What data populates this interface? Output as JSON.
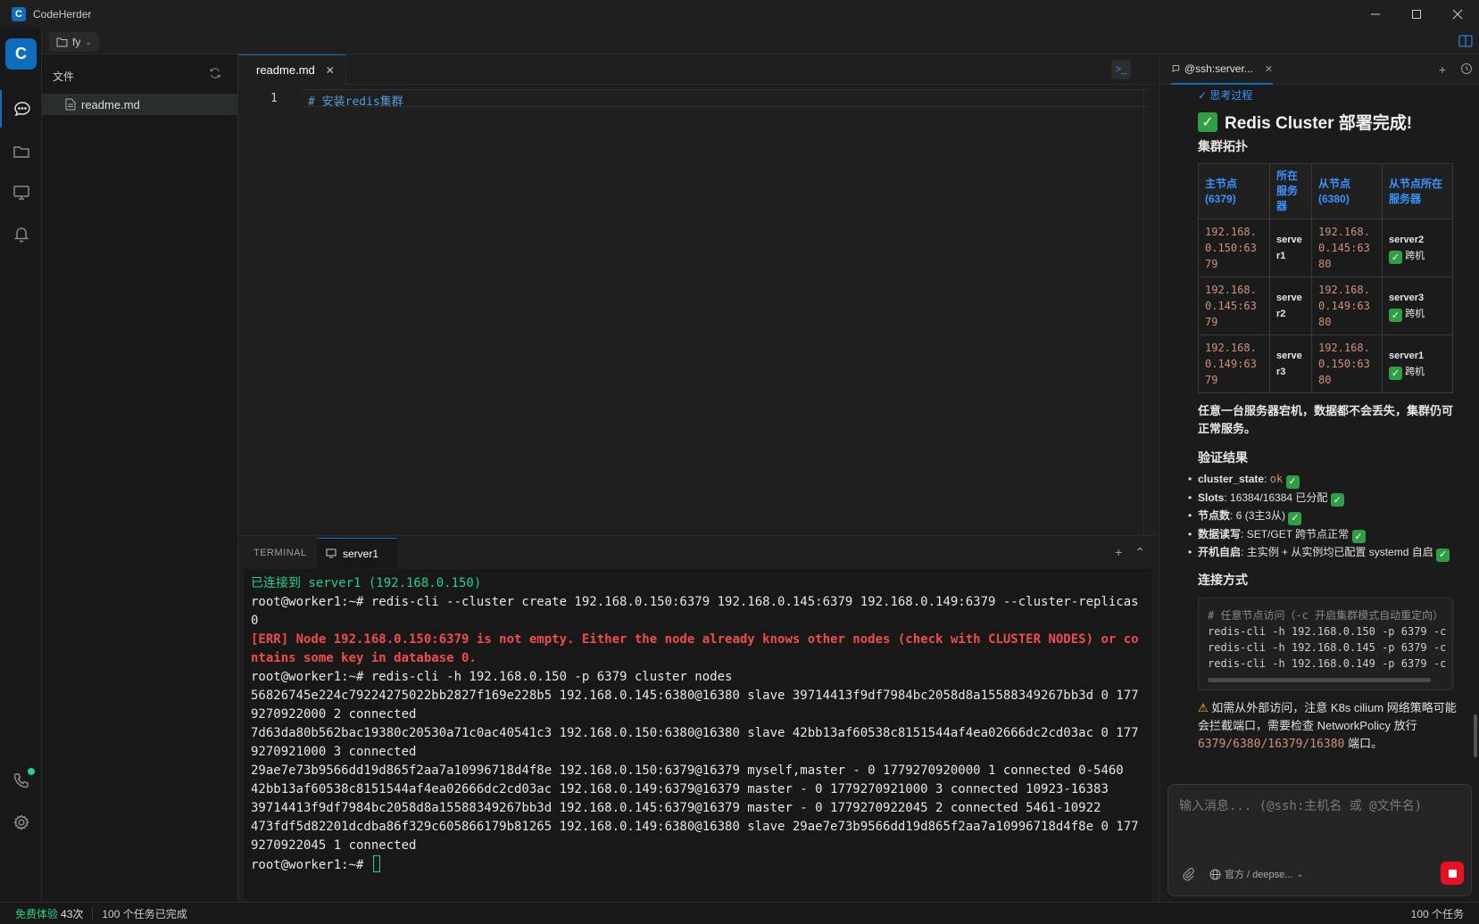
{
  "app": {
    "name": "CodeHerder",
    "logo_letter": "C",
    "accent": "#0e6dbd"
  },
  "activity": {
    "avatar_letter": "C",
    "items": [
      "chat-icon",
      "folder-icon",
      "monitor-icon",
      "bell-icon",
      "phone-icon",
      "gear-icon"
    ],
    "active": "chat-icon"
  },
  "workspace": {
    "name": "fy"
  },
  "explorer": {
    "title": "文件",
    "files": [
      {
        "name": "readme.md"
      }
    ]
  },
  "editor": {
    "tab": "readme.md",
    "line_number": "1",
    "code": "# 安装redis集群"
  },
  "terminal": {
    "label": "TERMINAL",
    "tab": "server1",
    "connected": "已连接到 server1 (192.168.0.150)",
    "prompt": "root@worker1:~# ",
    "cmd1": "redis-cli --cluster create 192.168.0.150:6379 192.168.0.145:6379 192.168.0.149:6379 --cluster-replicas 0",
    "err": "[ERR] Node 192.168.0.150:6379 is not empty. Either the node already knows other nodes (check with CLUSTER NODES) or contains some key in database 0.",
    "cmd2": "redis-cli -h 192.168.0.150 -p 6379 cluster nodes",
    "out1": "56826745e224c79224275022bb2827f169e228b5 192.168.0.145:6380@16380 slave 39714413f9df7984bc2058d8a15588349267bb3d 0 1779270922000 2 connected",
    "out2": "7d63da80b562bac19380c20530a71c0ac40541c3 192.168.0.150:6380@16380 slave 42bb13af60538c8151544af4ea02666dc2cd03ac 0 1779270921000 3 connected",
    "out3": "29ae7e73b9566dd19d865f2aa7a10996718d4f8e 192.168.0.150:6379@16379 myself,master - 0 1779270920000 1 connected 0-5460",
    "out4": "42bb13af60538c8151544af4ea02666dc2cd03ac 192.168.0.149:6379@16379 master - 0 1779270921000 3 connected 10923-16383",
    "out5": "39714413f9df7984bc2058d8a15588349267bb3d 192.168.0.145:6379@16379 master - 0 1779270922045 2 connected 5461-10922",
    "out6": "473fdf5d82201dcdba86f329c605866179b81265 192.168.0.149:6380@16380 slave 29ae7e73b9566dd19d865f2aa7a10996718d4f8e 0 1779270922045 1 connected",
    "prompt_end": "root@worker1:~#"
  },
  "chat": {
    "tab": "@ssh:server...",
    "thinking": "✓ 思考过程",
    "heading": "Redis Cluster 部署完成!",
    "topology_title": "集群拓扑",
    "table": {
      "headers": [
        "主节点 (6379)",
        "所在服务器",
        "从节点 (6380)",
        "从节点所在服务器"
      ],
      "rows": [
        {
          "master": "192.168.0.150:6379",
          "server": "server1",
          "slave": "192.168.0.145:6380",
          "slave_server": "server2",
          "cross": "跨机"
        },
        {
          "master": "192.168.0.145:6379",
          "server": "server2",
          "slave": "192.168.0.149:6380",
          "slave_server": "server3",
          "cross": "跨机"
        },
        {
          "master": "192.168.0.149:6379",
          "server": "server3",
          "slave": "192.168.0.150:6380",
          "slave_server": "server1",
          "cross": "跨机"
        }
      ]
    },
    "ha_note": "任意一台服务器宕机，数据都不会丢失，集群仍可正常服务。",
    "verify_title": "验证结果",
    "verify": [
      {
        "key": "cluster_state",
        "value": "ok",
        "code": true
      },
      {
        "key": "Slots",
        "value": "16384/16384 已分配"
      },
      {
        "key": "节点数",
        "value": "6 (3主3从)"
      },
      {
        "key": "数据读写",
        "value": "SET/GET 跨节点正常"
      },
      {
        "key": "开机自启",
        "value": "主实例 + 从实例均已配置 systemd 自启"
      }
    ],
    "connect_title": "连接方式",
    "code_comment": "# 任意节点访问（-c 开启集群模式自动重定向）",
    "code_lines": [
      "redis-cli -h 192.168.0.150 -p 6379 -c",
      "redis-cli -h 192.168.0.145 -p 6379 -c",
      "redis-cli -h 192.168.0.149 -p 6379 -c"
    ],
    "warn_text": "如需从外部访问，注意 K8s cilium 网络策略可能会拦截端口，需要检查 NetworkPolicy 放行",
    "warn_ports": "6379/6380/16379/16380",
    "warn_tail": "端口。",
    "input_placeholder": "输入消息... (@ssh:主机名 或 @文件名)",
    "model": "官方 / deepse..."
  },
  "status": {
    "trial": "免费体验",
    "trial_count": "43次",
    "tasks_done": "100 个任务已完成",
    "tasks_right": "100 个任务"
  }
}
